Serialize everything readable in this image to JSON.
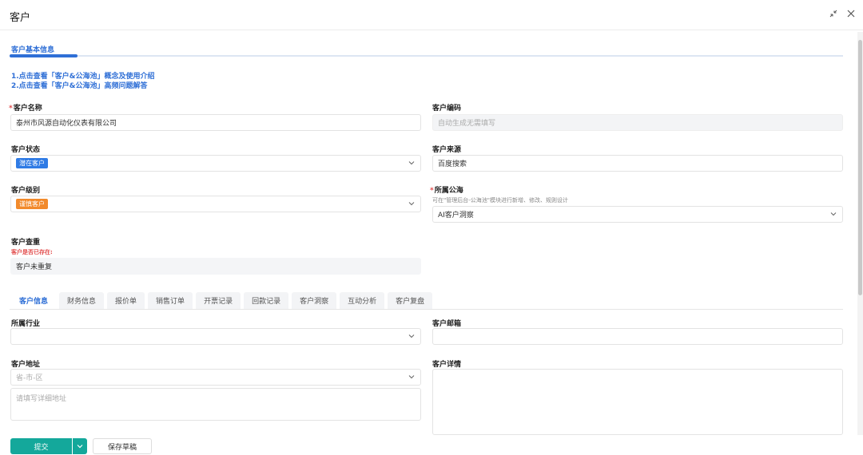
{
  "header": {
    "title": "客户",
    "collapse_icon": "collapse-arrows-icon",
    "close_icon": "close-icon"
  },
  "section": {
    "tab_label": "客户基本信息",
    "links": [
      "1.点击查看「客户&公海池」概念及使用介绍",
      "2.点击查看「客户&公海池」高频问题解答"
    ]
  },
  "form": {
    "customer_name": {
      "label": "客户名称",
      "required_mark": "*",
      "value": "泰州市风源自动化仪表有限公司"
    },
    "customer_code": {
      "label": "客户编码",
      "placeholder": "自动生成无需填写"
    },
    "customer_status": {
      "label": "客户状态",
      "value": "潜在客户",
      "tag_color": "#2f7be5"
    },
    "customer_source": {
      "label": "客户来源",
      "value": "百度搜索"
    },
    "customer_level": {
      "label": "客户级别",
      "value": "谨慎客户",
      "tag_color": "#f28a2b"
    },
    "public_pool": {
      "label": "所属公海",
      "required_mark": "*",
      "hint": "可在\"管理后台-公海池\"模块进行新增、修改、规则设计",
      "value": "AI客户洞察"
    },
    "duplicate_check": {
      "label": "客户查重",
      "warning": "客户是否已存在:",
      "value": "客户未重复"
    }
  },
  "tabs": [
    "客户信息",
    "财务信息",
    "报价单",
    "销售订单",
    "开票记录",
    "回款记录",
    "客户洞察",
    "互动分析",
    "客户复盘"
  ],
  "detail": {
    "industry": {
      "label": "所属行业",
      "value": ""
    },
    "email": {
      "label": "客户邮箱",
      "value": ""
    },
    "address": {
      "label": "客户地址",
      "region_placeholder": "省-市-区",
      "detail_placeholder": "请填写详细地址"
    },
    "description": {
      "label": "客户详情"
    }
  },
  "footer": {
    "submit_label": "提交",
    "draft_label": "保存草稿"
  },
  "colors": {
    "primary": "#2f6fd6",
    "submit": "#14a89b",
    "required": "#e24b4b"
  }
}
